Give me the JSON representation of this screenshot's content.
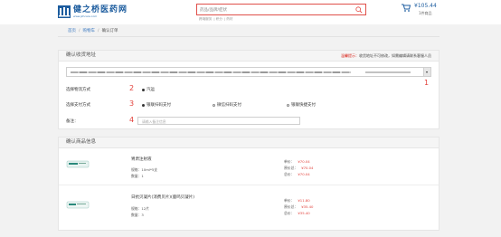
{
  "header": {
    "brand": "健之桥医药网",
    "brand_url": "www.jzhcare.com",
    "search_placeholder": "药品/品牌/症状",
    "hot_links": [
      "跨境服务",
      "积分",
      "药材"
    ],
    "cart_total": "¥105.44",
    "cart_count": "1件商品"
  },
  "breadcrumb": {
    "home": "首页",
    "cart": "购物车",
    "current": "确认订单"
  },
  "address_section": {
    "title": "确认收货地址",
    "hint_prefix": "温馨提示：",
    "hint_text": "收货地址不可修改，如需编辑请联系客服人员",
    "annotation": "1"
  },
  "logistics": {
    "label": "选择物流方式",
    "annotation": "2",
    "option": "汽运"
  },
  "payment": {
    "label": "选择支付方式",
    "annotation": "3",
    "options": [
      "银联扫码支付",
      "微信扫码支付",
      "银联快捷支付"
    ]
  },
  "remark": {
    "label": "备注：",
    "annotation": "4",
    "placeholder": "请输入备注信息"
  },
  "products_section": {
    "title": "确认商品信息",
    "unit_price_label": "单价：",
    "cost_label": "原价总：",
    "total_label": "总价：",
    "items": [
      {
        "name": "胃肃注射液",
        "spec": "规格：10ml*5支",
        "qty": "数量：1",
        "unit_price": "¥70.04",
        "cost": "¥70.04",
        "total": "¥70.04"
      },
      {
        "name": "日抗贝凝片(消费贝片)(鹿鸣贝凝片)",
        "spec": "规格：12片",
        "qty": "数量：3",
        "unit_price": "¥11.80",
        "cost": "¥35.40",
        "total": "¥35.40"
      }
    ]
  },
  "colors": {
    "accent_red": "#e2413b",
    "brand_blue": "#1c5c9e",
    "link_blue": "#3a78c0"
  }
}
